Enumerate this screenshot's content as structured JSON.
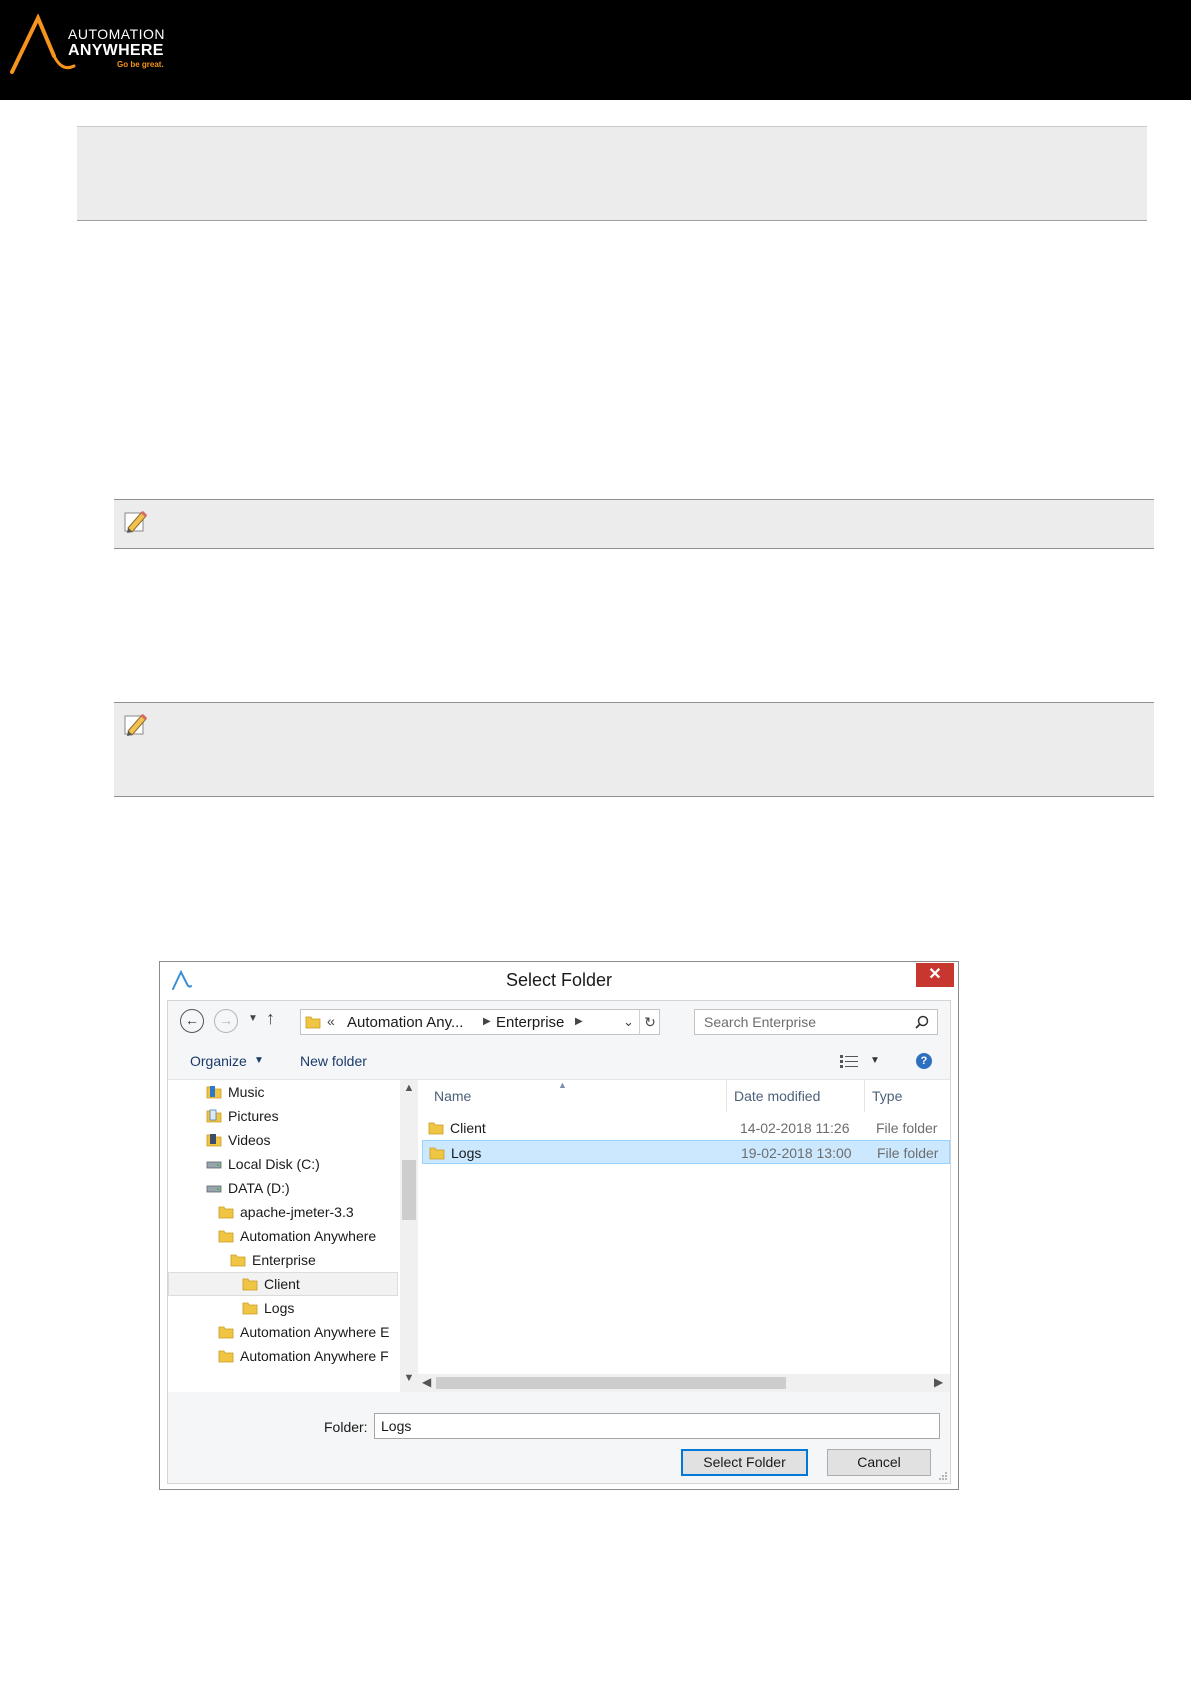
{
  "brand": {
    "line1": "AUTOMATION",
    "line2": "ANYWHERE",
    "tagline": "Go be great.",
    "accent_color": "#f7941d"
  },
  "dialog": {
    "title": "Select Folder",
    "close_label": "✕",
    "nav": {
      "back_icon": "back-arrow-icon",
      "forward_icon": "forward-arrow-icon",
      "up_icon": "up-arrow-icon"
    },
    "address": {
      "prefix": "«",
      "segment1": "Automation Any...",
      "segment2": "Enterprise"
    },
    "search": {
      "placeholder": "Search Enterprise"
    },
    "toolbar": {
      "organize": "Organize",
      "new_folder": "New folder"
    },
    "tree": [
      {
        "label": "Music",
        "icon": "music-folder-icon"
      },
      {
        "label": "Pictures",
        "icon": "pictures-folder-icon"
      },
      {
        "label": "Videos",
        "icon": "videos-folder-icon"
      },
      {
        "label": "Local Disk (C:)",
        "icon": "drive-icon"
      },
      {
        "label": "DATA (D:)",
        "icon": "drive-icon"
      },
      {
        "label": "apache-jmeter-3.3",
        "icon": "folder-icon"
      },
      {
        "label": "Automation Anywhere",
        "icon": "folder-icon"
      },
      {
        "label": "Enterprise",
        "icon": "folder-icon",
        "selected": true
      },
      {
        "label": "Client",
        "icon": "folder-icon"
      },
      {
        "label": "Logs",
        "icon": "folder-icon"
      },
      {
        "label": "Automation Anywhere E",
        "icon": "folder-icon"
      },
      {
        "label": "Automation Anywhere F",
        "icon": "folder-icon"
      }
    ],
    "columns": {
      "name": "Name",
      "date": "Date modified",
      "type": "Type"
    },
    "files": [
      {
        "name": "Client",
        "date": "14-02-2018 11:26",
        "type": "File folder",
        "selected": false
      },
      {
        "name": "Logs",
        "date": "19-02-2018 13:00",
        "type": "File folder",
        "selected": true
      }
    ],
    "folder_label": "Folder:",
    "folder_value": "Logs",
    "buttons": {
      "select": "Select Folder",
      "cancel": "Cancel"
    }
  },
  "colors": {
    "header_bg": "#000000",
    "note_bg": "#ececec",
    "selection_bg": "#cce8ff",
    "close_bg": "#c7372f"
  }
}
